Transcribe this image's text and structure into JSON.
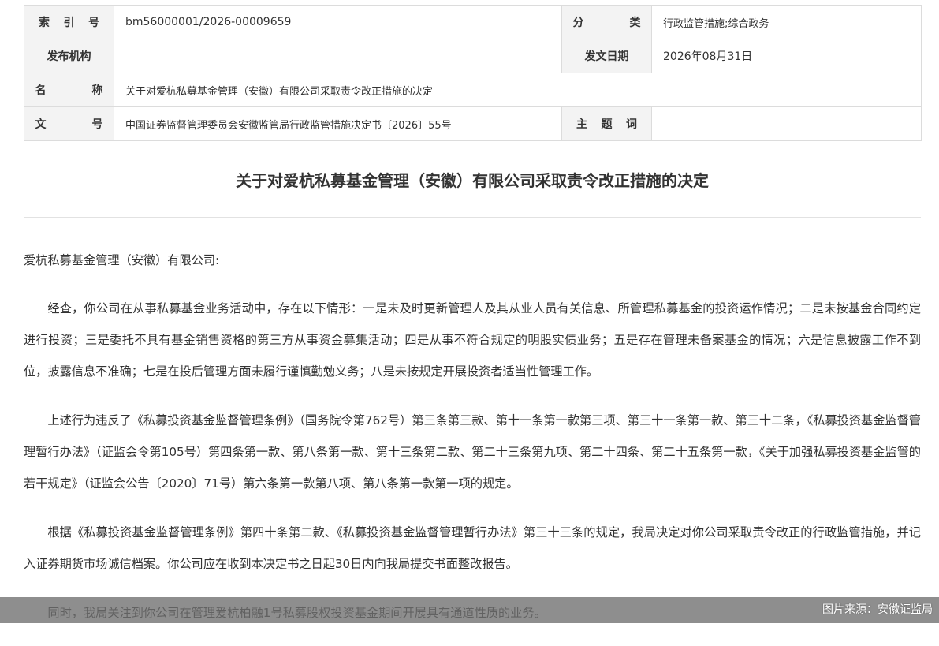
{
  "meta": {
    "index_label": "索 引 号",
    "index_value": "bm56000001/2026-00009659",
    "category_label": "分 类",
    "category_value": "行政监管措施;综合政务",
    "issuer_label": "发布机构",
    "issuer_value": "",
    "date_label": "发文日期",
    "date_value": "2026年08月31日",
    "name_label": "名 称",
    "name_value": "关于对爱杭私募基金管理（安徽）有限公司采取责令改正措施的决定",
    "docno_label": "文 号",
    "docno_value": "中国证券监督管理委员会安徽监管局行政监管措施决定书〔2026〕55号",
    "keywords_label": "主 题 词",
    "keywords_value": ""
  },
  "document": {
    "title": "关于对爱杭私募基金管理（安徽）有限公司采取责令改正措施的决定",
    "salutation": "爱杭私募基金管理（安徽）有限公司:",
    "paragraphs": [
      "经查，你公司在从事私募基金业务活动中，存在以下情形：一是未及时更新管理人及其从业人员有关信息、所管理私募基金的投资运作情况；二是未按基金合同约定进行投资；三是委托不具有基金销售资格的第三方从事资金募集活动；四是从事不符合规定的明股实债业务；五是存在管理未备案基金的情况；六是信息披露工作不到位，披露信息不准确；七是在投后管理方面未履行谨慎勤勉义务；八是未按规定开展投资者适当性管理工作。",
      "上述行为违反了《私募投资基金监督管理条例》（国务院令第762号）第三条第三款、第十一条第一款第三项、第三十一条第一款、第三十二条，《私募投资基金监督管理暂行办法》（证监会令第105号）第四条第一款、第八条第一款、第十三条第二款、第二十三条第九项、第二十四条、第二十五条第一款，《关于加强私募投资基金监管的若干规定》（证监会公告〔2020〕71号）第六条第一款第八项、第八条第一款第一项的规定。",
      "根据《私募投资基金监督管理条例》第四十条第二款、《私募投资基金监督管理暂行办法》第三十三条的规定，我局决定对你公司采取责令改正的行政监管措施，并记入证券期货市场诚信档案。你公司应在收到本决定书之日起30日内向我局提交书面整改报告。",
      "同时，我局关注到你公司在管理爱杭柏融1号私募股权投资基金期间开展具有通道性质的业务。"
    ]
  },
  "caption": {
    "source": "图片来源：安徽证监局"
  }
}
